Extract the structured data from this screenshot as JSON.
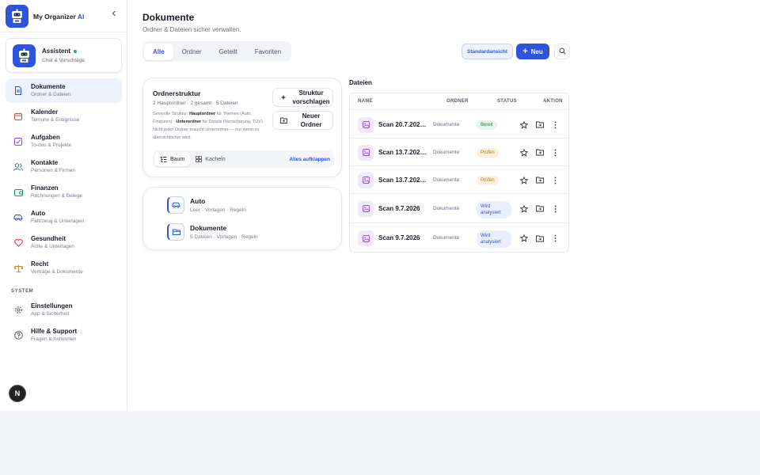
{
  "app": {
    "name": "My Organizer",
    "name_accent": "AI"
  },
  "assistant": {
    "title": "Assistent",
    "subtitle": "Chat & Vorschläge"
  },
  "nav": [
    {
      "label": "Dokumente",
      "sub": "Ordner & Dateien",
      "icon": "document-icon",
      "color": "#2f54d9"
    },
    {
      "label": "Kalender",
      "sub": "Termine & Ereignisse",
      "icon": "calendar-icon",
      "color": "#e04646"
    },
    {
      "label": "Aufgaben",
      "sub": "To-dos & Projekte",
      "icon": "checkbox-icon",
      "color": "#8a4fd6"
    },
    {
      "label": "Kontakte",
      "sub": "Personen & Firmen",
      "icon": "users-icon",
      "color": "#2f6fd9"
    },
    {
      "label": "Finanzen",
      "sub": "Rechnungen & Belege",
      "icon": "wallet-icon",
      "color": "#1b9a55"
    },
    {
      "label": "Auto",
      "sub": "Fahrzeug & Unterlagen",
      "icon": "car-icon",
      "color": "#2f54d9"
    },
    {
      "label": "Gesundheit",
      "sub": "Ärzte & Unterlagen",
      "icon": "heart-icon",
      "color": "#e04646"
    },
    {
      "label": "Recht",
      "sub": "Verträge & Dokumente",
      "icon": "scale-icon",
      "color": "#d98a1f"
    }
  ],
  "system": {
    "label": "SYSTEM",
    "items": [
      {
        "label": "Einstellungen",
        "sub": "App & Sicherheit",
        "icon": "gear-icon"
      },
      {
        "label": "Hilfe & Support",
        "sub": "Fragen & Antworten",
        "icon": "help-icon"
      }
    ]
  },
  "fab": {
    "label": "N"
  },
  "page": {
    "title": "Dokumente",
    "subtitle": "Ordner & Dateien sicher verwalten."
  },
  "tabs": [
    "Alle",
    "Ordner",
    "Geteilt",
    "Favoriten"
  ],
  "toolbar": {
    "std_label": "Standardansicht",
    "new_label": "Neu"
  },
  "structure": {
    "title": "Ordnerstruktur",
    "meta": "2 Hauptordner · 2 gesamt · 5 Dateien",
    "desc_1": "Sinnvolle Struktur:",
    "desc_b1": "Hauptordner",
    "desc_2": "für Themen (Auto, Finanzen) ·",
    "desc_b2": "Unterordner",
    "desc_3": "für Details (Versicherung, TÜV). Nicht jeder Ordner braucht Unterordner — nur wenn es übersichtlicher wird.",
    "suggest_label_1": "Struktur",
    "suggest_label_2": "vorschlagen",
    "newfolder_label_1": "Neuer",
    "newfolder_label_2": "Ordner",
    "view_tree": "Baum",
    "view_tiles": "Kacheln",
    "expand_all": "Alles aufklappen"
  },
  "folders": [
    {
      "name": "Auto",
      "sub": "Leer · Vorlagen · Regeln"
    },
    {
      "name": "Dokumente",
      "sub": "5 Dateien · Vorlagen · Regeln"
    }
  ],
  "files": {
    "title": "Dateien",
    "headers": {
      "name": "NAME",
      "folder": "ORDNER",
      "status": "STATUS",
      "action": "AKTION"
    },
    "rows": [
      {
        "name": "Scan 20.7.2026 …",
        "folder": "Dokumente",
        "status": "Bereit",
        "kind": "ready"
      },
      {
        "name": "Scan 13.7.2026 …",
        "folder": "Dokumente",
        "status": "Prüfen",
        "kind": "check"
      },
      {
        "name": "Scan 13.7.2026 …",
        "folder": "Dokumente",
        "status": "Prüfen",
        "kind": "check"
      },
      {
        "name": "Scan 9.7.2026",
        "folder": "Dokumente",
        "status": "Wird analysiert",
        "kind": "ana"
      },
      {
        "name": "Scan 9.7.2026",
        "folder": "Dokumente",
        "status": "Wird analysiert",
        "kind": "ana"
      }
    ]
  }
}
